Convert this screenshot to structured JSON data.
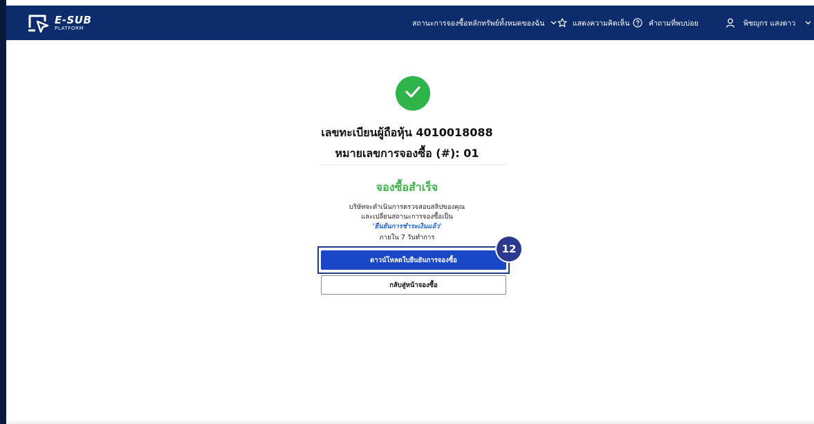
{
  "header": {
    "logo_main": "E-SUB",
    "logo_sub": "PLATFORM",
    "nav_subscriptions": "สถานะการจองซื้อหลักทรัพย์ทั้งหมดของฉัน",
    "nav_feedback": "แสดงความคิดเห็น",
    "nav_faq": "คำถามที่พบบ่อย",
    "user_name": "พิชญุกร แสงดาว",
    "icons": {
      "logo": "esub-logo-icon",
      "chevron": "chevron-down-icon",
      "feedback": "star-outline-icon",
      "faq": "question-circle-icon",
      "user": "user-icon"
    }
  },
  "result": {
    "icon": "check-icon",
    "shareholder_line": "เลขทะเบียนผู้ถือหุ้น 4010018088",
    "subscription_line": "หมายเลขการจองซื้อ (#): 01",
    "success_title": "จองซื้อสำเร็จ",
    "desc_1": "บริษัทจะดำเนินการตรวจสอบสลิปของคุณ",
    "desc_2": "และเปลี่ยนสถานะการจองซื้อเป็น",
    "desc_status": "'ยืนยันการชำระเงินแล้ว'",
    "desc_3": "ภายใน 7 วันทำการ"
  },
  "actions": {
    "download_label": "ดาวน์โหลดใบยืนยันการจองซื้อ",
    "back_label": "กลับสู่หน้าจองซื้อ",
    "step_number": "12"
  },
  "colors": {
    "header_bg": "#0d2c6b",
    "success_green": "#2fb44a",
    "primary_blue": "#1a47c7",
    "badge_navy": "#2b3a8f"
  }
}
